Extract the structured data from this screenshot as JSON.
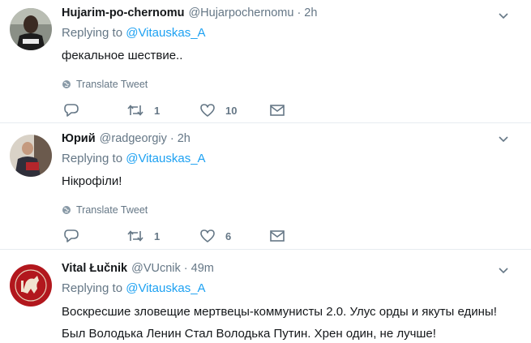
{
  "tweets": [
    {
      "name": "Hujarim-po-chernomu",
      "handle": "@Hujarpochernomu",
      "dot": "·",
      "time": "2h",
      "replying_prefix": "Replying to",
      "replying_to": "@Vitauskas_A",
      "text": "фекальное шествие..",
      "translate": "Translate Tweet",
      "retweets": "1",
      "likes": "10"
    },
    {
      "name": "Юрий",
      "handle": "@radgeorgiy",
      "dot": "·",
      "time": "2h",
      "replying_prefix": "Replying to",
      "replying_to": "@Vitauskas_A",
      "text": "Нікрофіли!",
      "translate": "Translate Tweet",
      "retweets": "1",
      "likes": "6"
    },
    {
      "name": "Vital Łučnik",
      "handle": "@VUcnik",
      "dot": "·",
      "time": "49m",
      "replying_prefix": "Replying to",
      "replying_to": "@Vitauskas_A",
      "text_line1": "Воскресшие зловещие мертвецы-коммунисты 2.0. Улус орды и якуты едины!",
      "text_line2": "Был Володька Ленин Стал Володька Путин. Хрен один, не лучше!"
    }
  ],
  "icons": {
    "reply": "reply-icon",
    "retweet": "retweet-icon",
    "like": "heart-icon",
    "dm": "envelope-icon",
    "globe": "globe-icon",
    "caret": "chevron-down-icon"
  },
  "colors": {
    "link": "#1da1f2",
    "secondary": "#657786",
    "text": "#14171a",
    "divider": "#e6ecf0"
  }
}
